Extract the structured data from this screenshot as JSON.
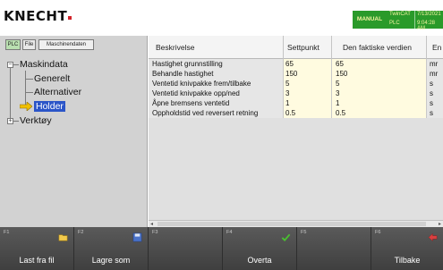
{
  "header": {
    "brand": "KNECHT",
    "mode": "MANUAL",
    "info": [
      {
        "label": "TwinCAT",
        "value": "7/13/2021"
      },
      {
        "label": "PLC",
        "value": "9:04:28 AM"
      }
    ]
  },
  "toggles": [
    "PLC",
    "File",
    "Maschinendaten"
  ],
  "tree": {
    "root": "Maskindata",
    "children": [
      "Generelt",
      "Alternativer",
      "Holder"
    ],
    "selected": "Holder",
    "sibling": "Verktøy"
  },
  "table": {
    "columns": [
      "Beskrivelse",
      "Settpunkt",
      "Den faktiske verdien",
      "En"
    ],
    "rows": [
      {
        "desc": "Hastighet grunnstilling",
        "set": "65",
        "actual": "65",
        "unit": "mr"
      },
      {
        "desc": "Behandle hastighet",
        "set": "150",
        "actual": "150",
        "unit": "mr"
      },
      {
        "desc": "Ventetid knivpakke frem/tilbake",
        "set": "5",
        "actual": "5",
        "unit": "s"
      },
      {
        "desc": "Ventetid knivpakke opp/ned",
        "set": "3",
        "actual": "3",
        "unit": "s"
      },
      {
        "desc": "Åpne bremsens ventetid",
        "set": "1",
        "actual": "1",
        "unit": "s"
      },
      {
        "desc": "Oppholdstid ved reversert retning",
        "set": "0.5",
        "actual": "0.5",
        "unit": "s"
      }
    ]
  },
  "fkeys": [
    {
      "num": "F1",
      "label": "Last fra fil",
      "icon": "folder-icon"
    },
    {
      "num": "F2",
      "label": "Lagre som",
      "icon": "save-icon"
    },
    {
      "num": "F3",
      "label": "",
      "icon": ""
    },
    {
      "num": "F4",
      "label": "Overta",
      "icon": "checkmark-icon"
    },
    {
      "num": "F5",
      "label": "",
      "icon": ""
    },
    {
      "num": "F6",
      "label": "Tilbake",
      "icon": "back-arrow-icon"
    }
  ],
  "colors": {
    "status_green": "#2a9a2a",
    "selection_blue": "#2b55c8",
    "value_cell": "#fffbe0",
    "brand_red": "#d2232a"
  }
}
